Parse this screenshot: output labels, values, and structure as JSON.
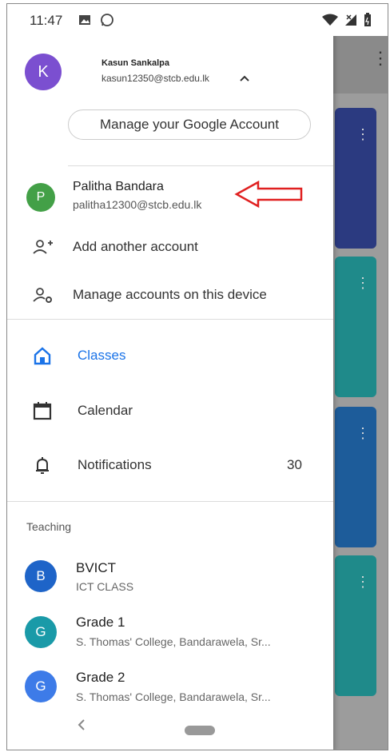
{
  "status_bar": {
    "time": "11:47"
  },
  "account": {
    "initial": "K",
    "name": "Kasun Sankalpa",
    "email": "kasun12350@stcb.edu.lk",
    "manage_label": "Manage your Google Account"
  },
  "other_account": {
    "initial": "P",
    "name": "Palitha Bandara",
    "email": "palitha12300@stcb.edu.lk"
  },
  "account_actions": {
    "add_label": "Add another account",
    "manage_label": "Manage accounts on this device"
  },
  "nav": {
    "classes": "Classes",
    "calendar": "Calendar",
    "notifications": "Notifications",
    "notifications_count": "30"
  },
  "teaching": {
    "title": "Teaching",
    "classes": [
      {
        "initial": "B",
        "title": "BVICT",
        "subtitle": "ICT CLASS",
        "color": "#1e64c8"
      },
      {
        "initial": "G",
        "title": "Grade 1",
        "subtitle": "S. Thomas' College, Bandarawela, Sr...",
        "color": "#1a9aa8"
      },
      {
        "initial": "G",
        "title": "Grade 2",
        "subtitle": "S. Thomas' College, Bandarawela, Sr...",
        "color": "#3d7be8"
      }
    ]
  },
  "colors": {
    "accent": "#1a73e8",
    "annotation_arrow": "#e02020"
  }
}
